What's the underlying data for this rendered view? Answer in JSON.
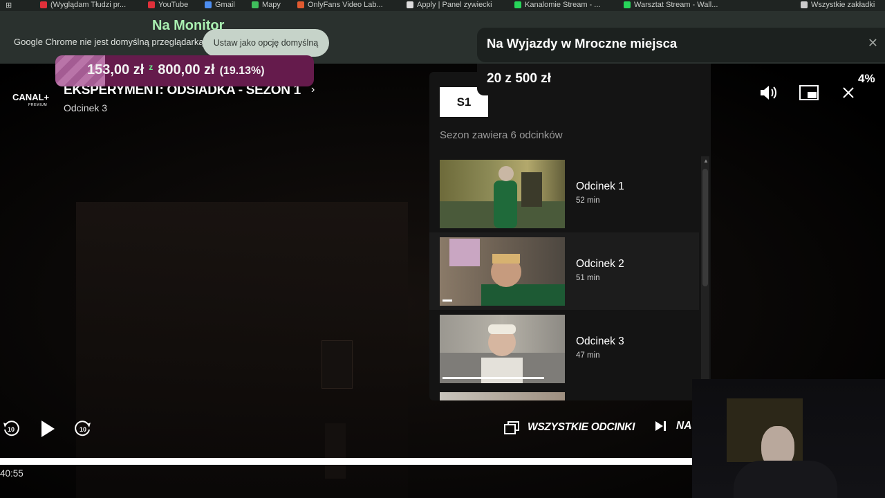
{
  "browser": {
    "bookmarks": [
      {
        "label": "(Wyglądam Tłudzi pr...",
        "color": "#e0303a"
      },
      {
        "label": "YouTube",
        "color": "#e0303a"
      },
      {
        "label": "Gmail",
        "color": "#4d8ef0"
      },
      {
        "label": "Mapy",
        "color": "#3fbf5c"
      },
      {
        "label": "OnlyFans Video Lab...",
        "color": "#e05a30"
      },
      {
        "label": "Apply | Panel zywiecki",
        "color": "#dddddd"
      },
      {
        "label": "Kanalomie Stream - ...",
        "color": "#27d65a"
      },
      {
        "label": "Warsztat Stream - Wall...",
        "color": "#27d65a"
      },
      {
        "label": "Wszystkie zakładki",
        "color": "#cccccc"
      }
    ],
    "infobar_text": "Google Chrome nie jest domyślną przeglądarką",
    "default_button": "Ustaw jako opcję domyślną"
  },
  "stream_overlay": {
    "monitor_label": "Na Monitor",
    "donation": {
      "current": "153,00 zł",
      "separator": "z",
      "goal": "800,00 zł",
      "percent_label": "(19.13%)",
      "fraction": 0.1913
    },
    "goal_title": "Na Wyjazdy w Mroczne miejsca",
    "goal_amount": "20 z 500 zł",
    "goal_percent": "4%"
  },
  "player": {
    "logo": "CANAL+",
    "logo_sub": "PREMIUM",
    "show_title": "EKSPERYMENT: ODSIADKA - SEZON 1",
    "current_episode": "Odcinek 3",
    "time": "40:55",
    "all_episodes_label": "WSZYSTKIE ODCINKI",
    "next_label": "NASTĘPNY ODCINEK",
    "progress_fraction": 1.0
  },
  "episodes_panel": {
    "season_tab": "S1",
    "season_info": "Sezon zawiera 6 odcinków",
    "episodes": [
      {
        "title": "Odcinek 1",
        "duration": "52 min",
        "watched_fraction": 0
      },
      {
        "title": "Odcinek 2",
        "duration": "51 min",
        "watched_fraction": 0.08
      },
      {
        "title": "Odcinek 3",
        "duration": "47 min",
        "watched_fraction": 0.85
      }
    ]
  }
}
